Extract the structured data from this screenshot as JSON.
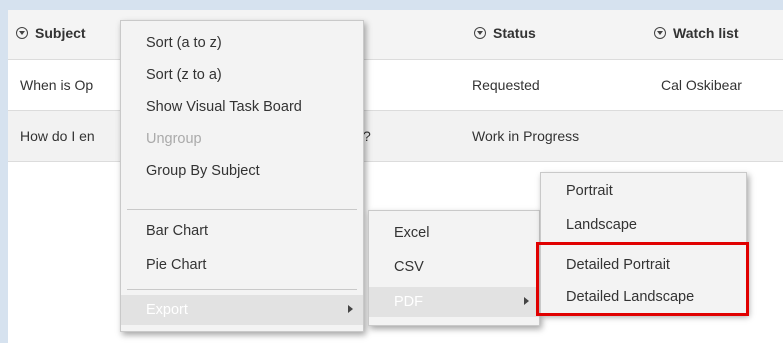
{
  "columns": {
    "subject": "Subject",
    "status": "Status",
    "watch_list": "Watch list"
  },
  "rows": [
    {
      "subject": "When is Op",
      "status": "Requested",
      "watch_list": "Cal Oskibear"
    },
    {
      "subject": "How do I en",
      "status": "Work in Progress",
      "watch_list": "",
      "trailing": "?"
    }
  ],
  "context_menu": {
    "items": [
      {
        "label": "Sort (a to z)"
      },
      {
        "label": "Sort (z to a)"
      },
      {
        "label": "Show Visual Task Board"
      },
      {
        "label": "Ungroup",
        "disabled": true
      },
      {
        "label": "Group By Subject"
      },
      {
        "label": "Bar Chart"
      },
      {
        "label": "Pie Chart"
      },
      {
        "label": "Export",
        "submenu": true
      }
    ]
  },
  "export_menu": {
    "items": [
      {
        "label": "Excel"
      },
      {
        "label": "CSV"
      },
      {
        "label": "PDF",
        "submenu": true
      }
    ]
  },
  "pdf_menu": {
    "items": [
      {
        "label": "Portrait"
      },
      {
        "label": "Landscape"
      },
      {
        "label": "Detailed Portrait"
      },
      {
        "label": "Detailed Landscape"
      }
    ]
  },
  "colors": {
    "highlight_border": "#e00000",
    "background": "#d6e2ef"
  }
}
